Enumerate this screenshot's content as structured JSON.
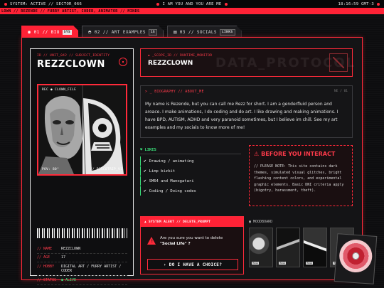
{
  "system": {
    "status": "SYSTEM: ACTIVE // SECTOR_066",
    "message": "I AM YOU AND YOU ARE ME",
    "clock": "18:16:59 GMT-3"
  },
  "ticker": "LOWN // REZENDE // FURRY ARTIST, CODER, ANIMATOR // MINDS",
  "tabs": [
    {
      "label": "01 // BIO",
      "badge": "SYS"
    },
    {
      "label": "02 // ART EXAMPLES",
      "badge": "15"
    },
    {
      "label": "03 // SOCIALS",
      "badge": "LINKS"
    }
  ],
  "idcard": {
    "subtitle": "ID // UNIT_042 // SUBJECT_IDENTITY",
    "name": "REZZCLOWN",
    "portrait_top_label": "REC ● CLOWN_FILE",
    "portrait_bottom_left": "POV: 80°",
    "portrait_bottom_right": "// DISCOTRIP_V1",
    "rows": [
      {
        "key": "// NAME",
        "value": "REZZCLOWN"
      },
      {
        "key": "// AGE",
        "value": "17"
      },
      {
        "key": "// HOBBY",
        "value": "DIGITAL ART / FURRY ARTIST / CODER"
      },
      {
        "key": "// STATUS",
        "value": "● ALIVE"
      }
    ]
  },
  "header": {
    "subtitle": "▪ _SCOPE_ID // RUNTIME_MONITOR",
    "title": "REZZCLOWN",
    "ghost": "DATA_PROTOCOL"
  },
  "bio": {
    "heading": "> _ BIOGRAPHY // ABOUT_ME",
    "num": "NE / 01",
    "text": "My name is Rezende, but you can call me Rezz for short. I am a genderfluid person and aroace. I make animations, I do coding and do art. I like drawing and making animations. I have BPD, AUTISM, ADHD and very paranoid sometimes, but I believe im chill. See my art examples and my socials to know more of me!"
  },
  "links": {
    "heading": "LIKES",
    "items": [
      "Drawing / animating",
      "Limp bizkit",
      "SM64 and Manogatari",
      "Coding / Doing codes"
    ]
  },
  "warning": {
    "heading": "BEFORE YOU INTERACT",
    "text": "// PLEASE NOTE: This site contains dark themes, simulated visual glitches, bright flashing content colors, and experimental graphic elements. Basic DNI criteria apply (bigotry, harassment, theft)."
  },
  "alert": {
    "heading": "SYSTEM ALERT // DELETE_PROMPT",
    "question": "Are you sure you want to delete",
    "target": "\"Social Life\" ?",
    "button": "DO I HAVE A CHOICE?"
  },
  "moodboard": {
    "heading": "MOODBOARD",
    "thumbs": [
      "MOOD",
      "MOOD",
      "MOOD",
      "MOOD"
    ]
  },
  "colors": {
    "accent": "#ff2236",
    "ok": "#3ae07a",
    "bg": "#0d0d0f"
  }
}
